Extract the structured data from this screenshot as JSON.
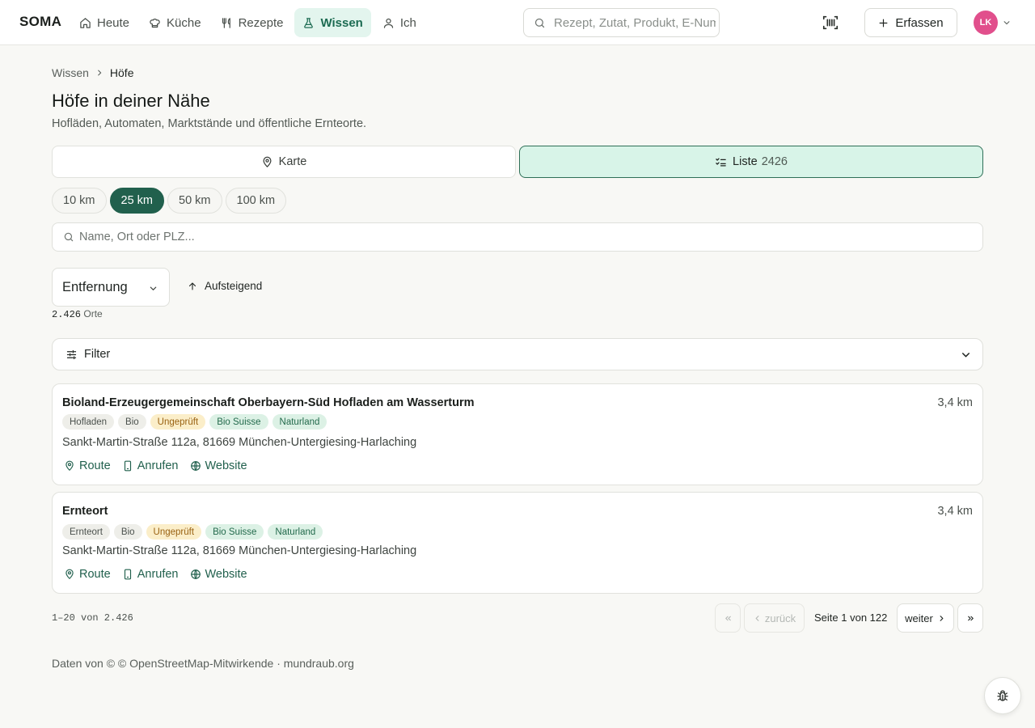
{
  "app": {
    "logo": "SOMA"
  },
  "nav": [
    {
      "label": "Heute",
      "icon": "home-icon"
    },
    {
      "label": "Küche",
      "icon": "chef-hat-icon"
    },
    {
      "label": "Rezepte",
      "icon": "utensils-icon"
    },
    {
      "label": "Wissen",
      "icon": "flask-icon",
      "active": true
    },
    {
      "label": "Ich",
      "icon": "user-icon"
    }
  ],
  "header": {
    "search_placeholder": "Rezept, Zutat, Produkt, E-Nummer",
    "capture_label": "Erfassen",
    "avatar_initials": "LK"
  },
  "breadcrumb": {
    "parent": "Wissen",
    "current": "Höfe"
  },
  "page": {
    "title": "Höfe in deiner Nähe",
    "subtitle": "Hofläden, Automaten, Marktstände und öffentliche Ernteorte."
  },
  "view_toggle": {
    "map_label": "Karte",
    "list_label": "Liste",
    "list_count": "2426",
    "active": "list"
  },
  "radius": {
    "options": [
      "10 km",
      "25 km",
      "50 km",
      "100 km"
    ],
    "selected": "25 km"
  },
  "search": {
    "placeholder": "Name, Ort oder PLZ..."
  },
  "sort": {
    "selected": "Entfernung",
    "direction_label": "Aufsteigend"
  },
  "results": {
    "count": "2.426",
    "unit": "Orte"
  },
  "filter": {
    "label": "Filter"
  },
  "cards": [
    {
      "title": "Bioland-Erzeugergemeinschaft Oberbayern-Süd Hofladen am Wasserturm",
      "distance": "3,4 km",
      "tags": [
        {
          "label": "Hofladen",
          "kind": "neutral"
        },
        {
          "label": "Bio",
          "kind": "neutral"
        },
        {
          "label": "Ungeprüft",
          "kind": "warn"
        },
        {
          "label": "Bio Suisse",
          "kind": "good"
        },
        {
          "label": "Naturland",
          "kind": "good"
        }
      ],
      "address": "Sankt-Martin-Straße 112a, 81669 München-Untergiesing-Harlaching",
      "actions": {
        "route": "Route",
        "call": "Anrufen",
        "website": "Website"
      }
    },
    {
      "title": "Ernteort",
      "distance": "3,4 km",
      "tags": [
        {
          "label": "Ernteort",
          "kind": "neutral"
        },
        {
          "label": "Bio",
          "kind": "neutral"
        },
        {
          "label": "Ungeprüft",
          "kind": "warn"
        },
        {
          "label": "Bio Suisse",
          "kind": "good"
        },
        {
          "label": "Naturland",
          "kind": "good"
        }
      ],
      "address": "Sankt-Martin-Straße 112a, 81669 München-Untergiesing-Harlaching",
      "actions": {
        "route": "Route",
        "call": "Anrufen",
        "website": "Website"
      }
    }
  ],
  "pagination": {
    "range": "1–20 von 2.426",
    "prev_label": "zurück",
    "info": "Seite 1 von 122",
    "next_label": "weiter"
  },
  "footer": {
    "attribution": "Daten von © © OpenStreetMap-Mitwirkende · mundraub.org"
  },
  "colors": {
    "accent": "#21604d",
    "accent_light": "#d8f4e8",
    "avatar": "#e14f8c",
    "warn_bg": "#fbeec9",
    "good_bg": "#dcf1e5"
  }
}
